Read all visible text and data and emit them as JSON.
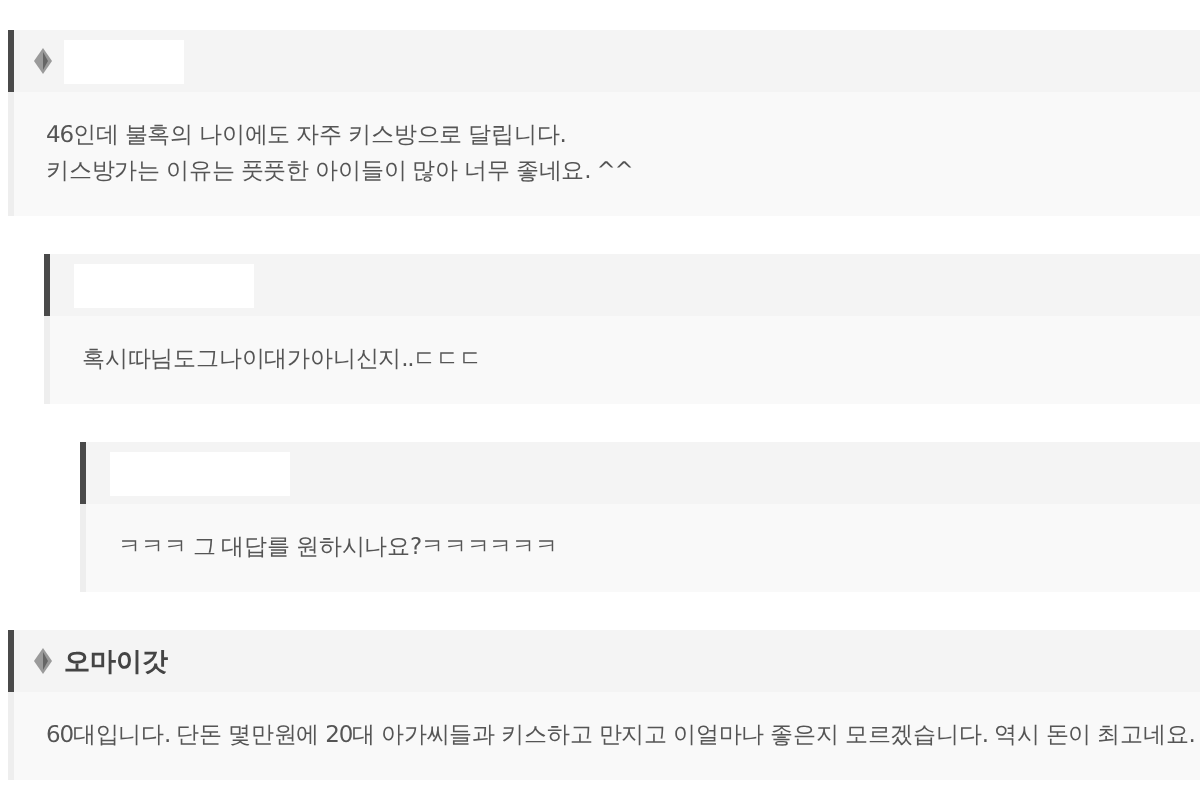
{
  "comments": [
    {
      "author_hidden": true,
      "icon": true,
      "lines": [
        "46인데 불혹의 나이에도 자주 키스방으로 달립니다.",
        "키스방가는 이유는 풋풋한 아이들이 많아 너무 좋네요. ^^"
      ],
      "children": [
        {
          "author_hidden": true,
          "icon": false,
          "lines": [
            "혹시따님도그나이대가아니신지..ㄷㄷㄷ"
          ],
          "children": [
            {
              "author_hidden": true,
              "icon": false,
              "lines": [
                "ㅋㅋㅋ  그 대답를 원하시나요?ㅋㅋㅋㅋㅋㅋ"
              ]
            }
          ]
        }
      ]
    },
    {
      "author": "오마이갓",
      "author_hidden": false,
      "icon": true,
      "lines": [
        "60대입니다. 단돈 몇만원에 20대 아가씨들과 키스하고 만지고 이얼마나 좋은지 모르겠습니다. 역시 돈이 최고네요."
      ]
    }
  ]
}
